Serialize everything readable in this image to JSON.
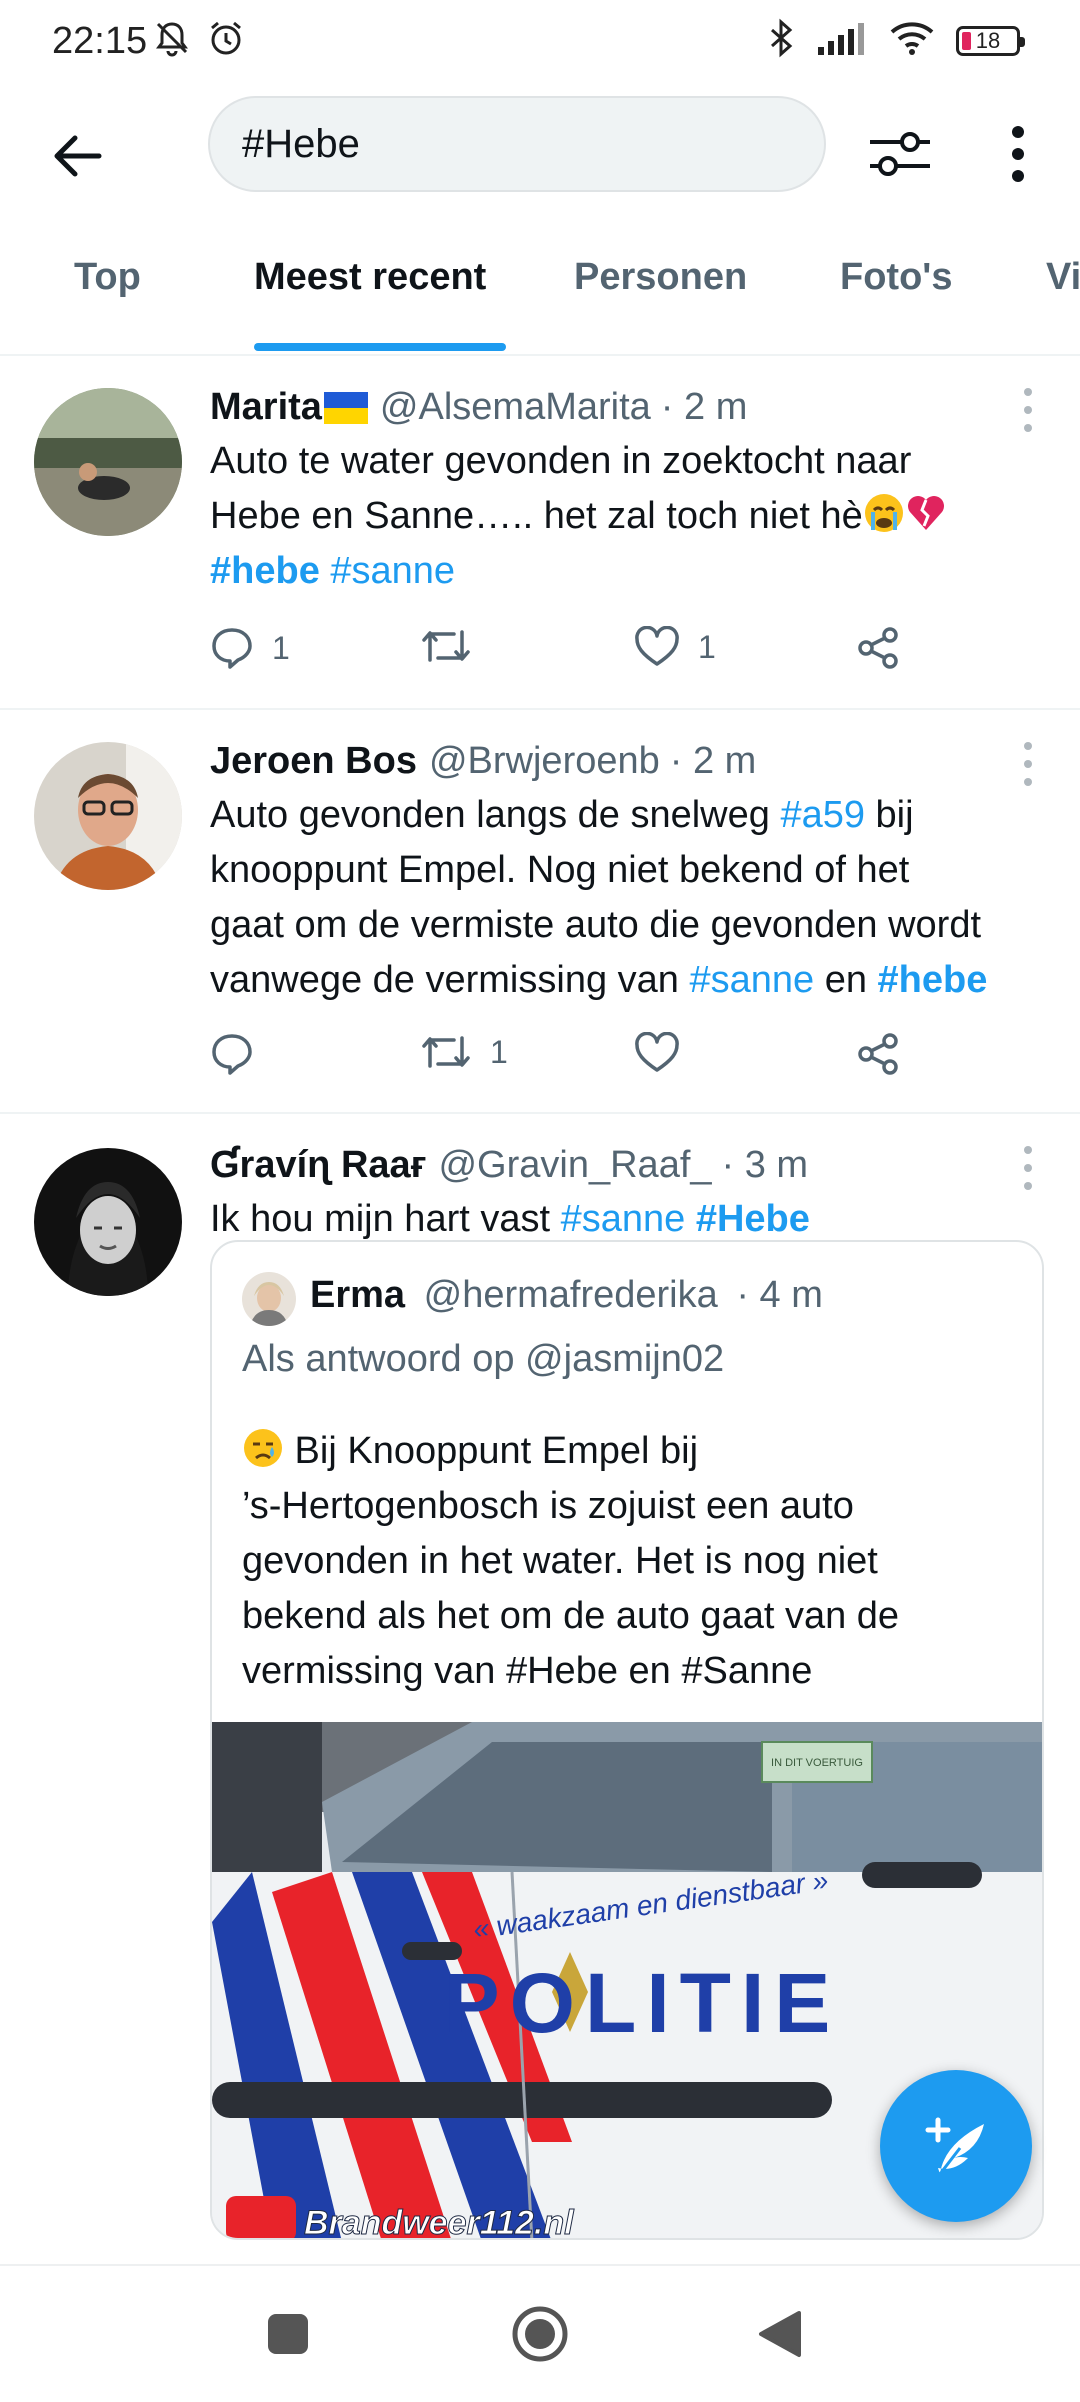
{
  "status_bar": {
    "time": "22:15",
    "battery": "18",
    "icons": [
      "bell-off-icon",
      "alarm-icon",
      "bluetooth-icon",
      "signal-icon",
      "wifi-icon",
      "battery-icon"
    ]
  },
  "header": {
    "search_value": "#Hebe"
  },
  "tabs": [
    {
      "label": "Top",
      "active": false
    },
    {
      "label": "Meest recent",
      "active": true
    },
    {
      "label": "Personen",
      "active": false
    },
    {
      "label": "Foto's",
      "active": false
    },
    {
      "label": "Vi",
      "active": false
    }
  ],
  "tweets": [
    {
      "name": "Marita",
      "handle": "@AlsemaMarita",
      "time": "· 2 m",
      "text_1": "Auto te water gevonden in zoektocht naar",
      "text_2": "Hebe en Sanne….. het zal toch niet hè",
      "tag_1": "#hebe",
      "tag_2": "#sanne",
      "replies": "1",
      "retweets": "",
      "likes": "1"
    },
    {
      "name": "Jeroen Bos",
      "handle": "@Brwjeroenb",
      "time": "· 2 m",
      "text_1": "Auto gevonden langs de snelweg ",
      "tag_1": "#a59",
      "text_2": " bij",
      "text_3": "knooppunt Empel. Nog niet bekend of het",
      "text_4": "gaat om de vermiste auto die gevonden wordt",
      "text_5": "vanwege de vermissing van ",
      "tag_2": "#sanne",
      "text_6": " en ",
      "tag_3": "#hebe",
      "replies": "",
      "retweets": "1",
      "likes": ""
    },
    {
      "name": "Ɠravíɳ Raaғ",
      "handle": "@Gravin_Raaf_",
      "time": "· 3 m",
      "text_1": "Ik hou mijn hart vast ",
      "tag_1": "#sanne",
      "tag_2": "#Hebe",
      "quote": {
        "name": "Erma",
        "handle": "@hermafrederika",
        "time": "· 4 m",
        "reply_to": "Als antwoord op @jasmijn02",
        "line_1": " Bij Knooppunt Empel bij",
        "line_2": "’s-Hertogenbosch is zojuist een auto",
        "line_3": "gevonden in het water. Het is nog niet",
        "line_4": "bekend als het om de auto gaat van de",
        "line_5": "vermissing van #Hebe en #Sanne",
        "image": {
          "slogan": "« waakzaam en dienstbaar »",
          "brand": "POLITIE",
          "sticker": "IN DIT VOERTUIG",
          "watermark": "Brandweer112.nl"
        }
      }
    }
  ],
  "colors": {
    "accent": "#1d9bf0",
    "text": "#0f1419",
    "secondary": "#536471"
  }
}
